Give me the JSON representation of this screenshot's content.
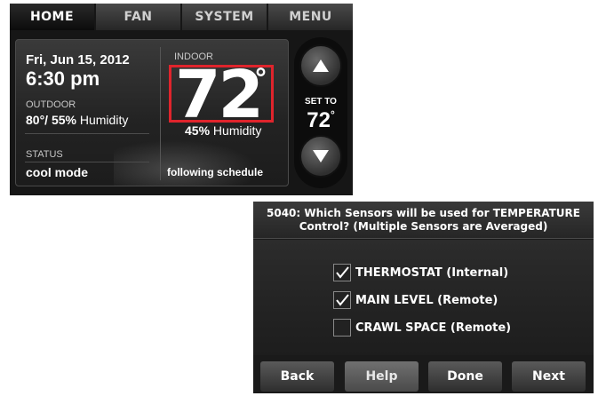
{
  "home": {
    "tabs": [
      "HOME",
      "FAN",
      "SYSTEM",
      "MENU"
    ],
    "active_tab": "HOME",
    "date": "Fri, Jun 15, 2012",
    "time": "6:30 pm",
    "outdoor_label": "OUTDOOR",
    "outdoor_temp": "80°/ 55%",
    "outdoor_humidity_suffix": " Humidity",
    "status_label": "STATUS",
    "status_value": "cool mode",
    "indoor_label": "INDOOR",
    "indoor_temp": "72",
    "degree_symbol": "°",
    "indoor_humidity_value": "45%",
    "indoor_humidity_suffix": " Humidity",
    "schedule": "following schedule",
    "set_to_label": "SET TO",
    "set_temp": "72",
    "up_icon": "up-arrow-icon",
    "down_icon": "down-arrow-icon",
    "highlight_color": "#e0242c"
  },
  "setup": {
    "header_line1": "5040: Which Sensors will be used for TEMPERATURE",
    "header_line2": "Control? (Multiple Sensors are Averaged)",
    "options": [
      {
        "label": "THERMOSTAT (Internal)",
        "checked": true
      },
      {
        "label": "MAIN LEVEL (Remote)",
        "checked": true
      },
      {
        "label": "CRAWL SPACE (Remote)",
        "checked": false
      }
    ],
    "buttons": {
      "back": "Back",
      "help": "Help",
      "done": "Done",
      "next": "Next"
    }
  }
}
